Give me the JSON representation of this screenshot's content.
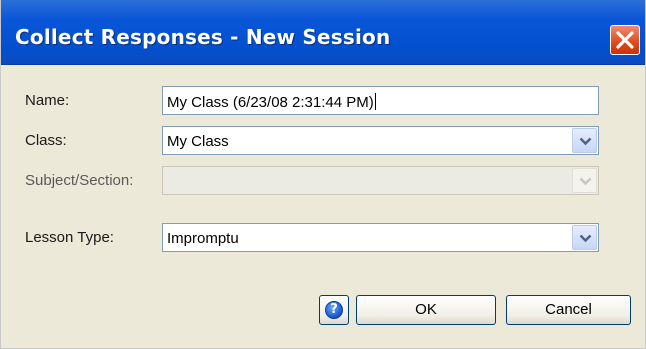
{
  "dialog": {
    "title": "Collect Responses - New Session",
    "close_icon": "close-x-icon"
  },
  "form": {
    "name_label": "Name:",
    "name_value": "My Class (6/23/08 2:31:44 PM)",
    "class_label": "Class:",
    "class_value": "My Class",
    "subject_label": "Subject/Section:",
    "subject_value": "",
    "lesson_type_label": "Lesson Type:",
    "lesson_type_value": "Impromptu"
  },
  "buttons": {
    "help_icon": "question-icon",
    "help_glyph": "?",
    "ok_label": "OK",
    "cancel_label": "Cancel"
  },
  "colors": {
    "titlebar": "#0a56d8",
    "dialog_bg": "#ece9d8",
    "close_button": "#e04a1c"
  }
}
